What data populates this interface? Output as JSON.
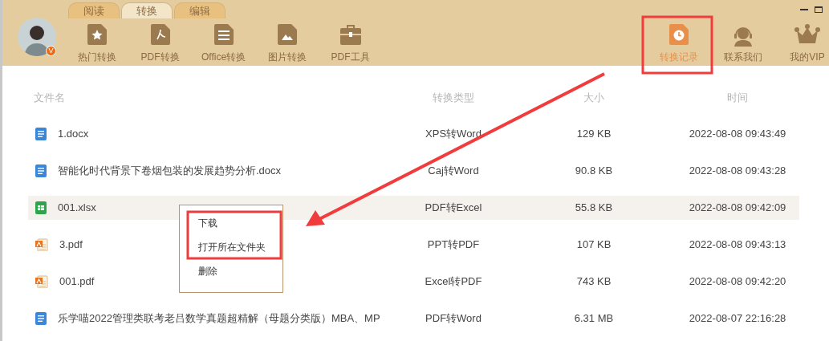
{
  "tabs": [
    {
      "label": "阅读",
      "selected": false
    },
    {
      "label": "转换",
      "selected": true
    },
    {
      "label": "编辑",
      "selected": false
    }
  ],
  "avatar": {
    "badge": "V"
  },
  "toolbar": [
    {
      "label": "热门转换",
      "kind": "hot"
    },
    {
      "label": "PDF转换",
      "kind": "pdf"
    },
    {
      "label": "Office转换",
      "kind": "office"
    },
    {
      "label": "图片转换",
      "kind": "image"
    },
    {
      "label": "PDF工具",
      "kind": "tool"
    }
  ],
  "right_actions": [
    {
      "label": "转换记录",
      "kind": "history",
      "selected": true
    },
    {
      "label": "联系我们",
      "kind": "contact",
      "selected": false
    },
    {
      "label": "我的VIP",
      "kind": "vip",
      "selected": false
    }
  ],
  "table": {
    "columns": [
      "文件名",
      "转换类型",
      "大小",
      "时间"
    ],
    "rows": [
      {
        "kind": "doc",
        "name": "1.docx",
        "type": "XPS转Word",
        "size": "129 KB",
        "time": "2022-08-08 09:43:49",
        "selected": false
      },
      {
        "kind": "doc",
        "name": "智能化时代背景下卷烟包装的发展趋势分析.docx",
        "type": "Caj转Word",
        "size": "90.8 KB",
        "time": "2022-08-08 09:43:28",
        "selected": false
      },
      {
        "kind": "sheet",
        "name": "001.xlsx",
        "type": "PDF转Excel",
        "size": "55.8 KB",
        "time": "2022-08-08 09:42:09",
        "selected": true
      },
      {
        "kind": "pdf",
        "name": "3.pdf",
        "type": "PPT转PDF",
        "size": "107 KB",
        "time": "2022-08-08 09:43:13",
        "selected": false
      },
      {
        "kind": "pdf",
        "name": "001.pdf",
        "type": "Excel转PDF",
        "size": "743 KB",
        "time": "2022-08-08 09:42:20",
        "selected": false
      },
      {
        "kind": "doc",
        "name": "乐学喵2022管理类联考老吕数学真题超精解（母题分类版）MBA、MP",
        "type": "PDF转Word",
        "size": "6.31 MB",
        "time": "2022-08-07 22:16:28",
        "selected": false
      }
    ]
  },
  "context_menu": {
    "items": [
      "下载",
      "打开所在文件夹",
      "删除"
    ]
  }
}
